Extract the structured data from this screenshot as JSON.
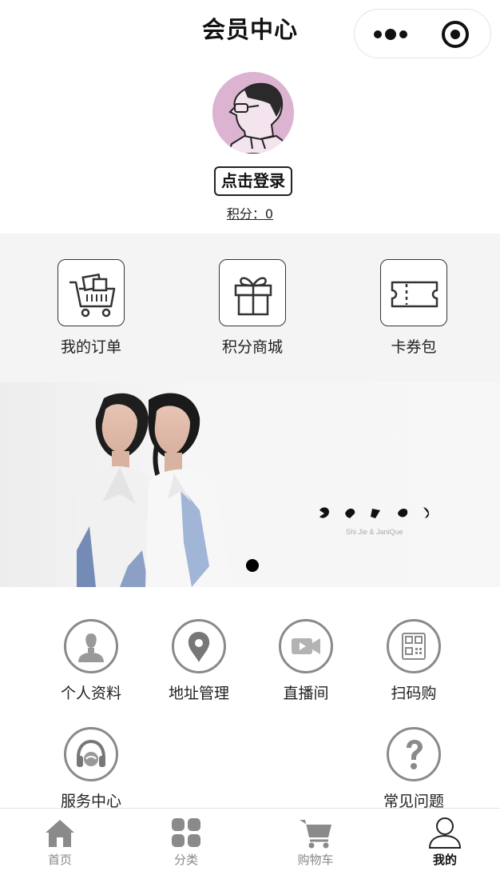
{
  "header": {
    "title": "会员中心"
  },
  "profile": {
    "login_label": "点击登录",
    "points_text": "积分：0"
  },
  "quick_menu": [
    {
      "label": "我的订单",
      "icon": "shopping-cart-icon"
    },
    {
      "label": "积分商城",
      "icon": "gift-icon"
    },
    {
      "label": "卡券包",
      "icon": "ticket-icon"
    }
  ],
  "banner": {
    "caption": "Shi Jie & JaniQue",
    "active_slide": 1,
    "slide_count": 1
  },
  "services": [
    {
      "label": "个人资料",
      "icon": "user-icon"
    },
    {
      "label": "地址管理",
      "icon": "location-pin-icon"
    },
    {
      "label": "直播间",
      "icon": "video-camera-icon"
    },
    {
      "label": "扫码购",
      "icon": "qr-code-icon"
    },
    {
      "label": "服务中心",
      "icon": "headset-icon"
    },
    {
      "label": "常见问题",
      "icon": "question-icon"
    }
  ],
  "tabbar": [
    {
      "label": "首页",
      "icon": "home-icon",
      "active": false
    },
    {
      "label": "分类",
      "icon": "grid-icon",
      "active": false
    },
    {
      "label": "购物车",
      "icon": "cart-icon",
      "active": false
    },
    {
      "label": "我的",
      "icon": "person-icon",
      "active": true
    }
  ],
  "colors": {
    "quick_bg": "#f4f4f4",
    "icon_gray": "#8a8a8a",
    "avatar_bg": "#e0b8d6",
    "active_tab": "#111111",
    "inactive_tab": "#888888"
  }
}
